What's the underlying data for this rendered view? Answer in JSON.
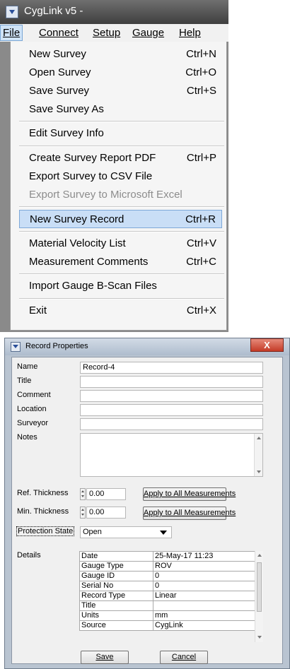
{
  "app_window": {
    "title": "CygLink v5 -",
    "menubar": [
      "File",
      "Connect",
      "Setup",
      "Gauge",
      "Help"
    ],
    "menu_items": [
      {
        "label": "New Survey",
        "shortcut": "Ctrl+N"
      },
      {
        "label": "Open Survey",
        "shortcut": "Ctrl+O"
      },
      {
        "label": "Save Survey",
        "shortcut": "Ctrl+S"
      },
      {
        "label": "Save Survey As",
        "shortcut": ""
      },
      {
        "label": "Edit Survey Info",
        "shortcut": ""
      },
      {
        "label": "Create Survey Report PDF",
        "shortcut": "Ctrl+P"
      },
      {
        "label": "Export Survey to CSV File",
        "shortcut": ""
      },
      {
        "label": "Export Survey to Microsoft Excel",
        "shortcut": "",
        "disabled": true
      },
      {
        "label": "New Survey Record",
        "shortcut": "Ctrl+R",
        "highlighted": true
      },
      {
        "label": "Material Velocity List",
        "shortcut": "Ctrl+V"
      },
      {
        "label": "Measurement Comments",
        "shortcut": "Ctrl+C"
      },
      {
        "label": "Import Gauge B-Scan Files",
        "shortcut": ""
      },
      {
        "label": "Exit",
        "shortcut": "Ctrl+X"
      }
    ]
  },
  "dialog": {
    "title": "Record Properties",
    "close_glyph": "X",
    "labels": {
      "name": "Name",
      "title": "Title",
      "comment": "Comment",
      "location": "Location",
      "surveyor": "Surveyor",
      "notes": "Notes",
      "ref_thickness": "Ref. Thickness",
      "min_thickness": "Min. Thickness",
      "protection_state": "Protection State",
      "details": "Details"
    },
    "fields": {
      "name": "Record-4",
      "title": "",
      "comment": "",
      "location": "",
      "surveyor": "",
      "notes": "",
      "ref_thickness": "0.00",
      "min_thickness": "0.00",
      "protection_state": "Open"
    },
    "apply_button": "Apply to All Measurements",
    "details": [
      [
        "Date",
        "25-May-17 11:23"
      ],
      [
        "Gauge Type",
        "ROV"
      ],
      [
        "Gauge ID",
        "0"
      ],
      [
        "Serial No",
        "0"
      ],
      [
        "Record Type",
        "Linear"
      ],
      [
        "Title",
        ""
      ],
      [
        "Units",
        "mm"
      ],
      [
        "Source",
        "CygLink"
      ]
    ],
    "save_button": "Save",
    "cancel_button": "Cancel"
  },
  "colors": {
    "menu_highlight": "#c9def6",
    "app_titlebar": "#4a4a4a",
    "dialog_close": "#c43b27"
  }
}
